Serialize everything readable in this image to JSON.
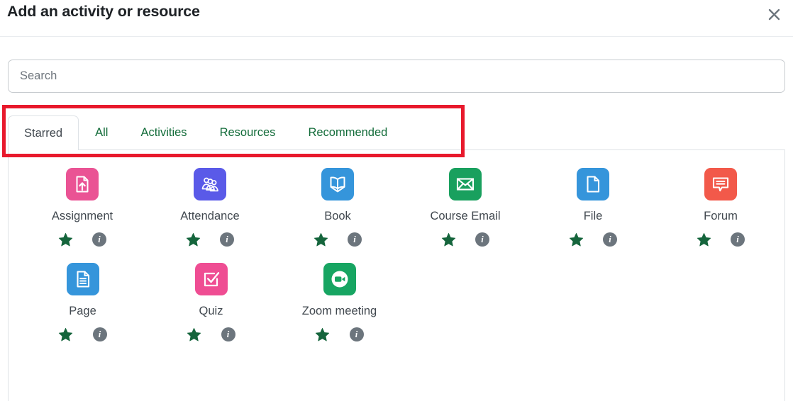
{
  "dialog": {
    "title": "Add an activity or resource",
    "close_label": "×",
    "close_icon": "close-icon"
  },
  "search": {
    "value": "",
    "placeholder": "Search"
  },
  "tabs": [
    {
      "label": "Starred",
      "active": true
    },
    {
      "label": "All",
      "active": false
    },
    {
      "label": "Activities",
      "active": false
    },
    {
      "label": "Resources",
      "active": false
    },
    {
      "label": "Recommended",
      "active": false
    }
  ],
  "annotation": {
    "shape": "rectangle",
    "color": "#e8192c",
    "target": "tab-bar"
  },
  "colors": {
    "tab_link": "#136c3a",
    "tab_active_text": "#41484f",
    "star": "#15653c",
    "info_badge": "#6c757d",
    "annotation": "#e8192c",
    "assignment": "#ea5394",
    "attendance": "#5a5ae8",
    "book": "#3595db",
    "course_email": "#19a05e",
    "file": "#3595db",
    "forum": "#f2594a",
    "page": "#3595db",
    "quiz": "#ef4d93",
    "zoom_meeting": "#17a562"
  },
  "modules": [
    {
      "name": "Assignment",
      "icon": "assignment-icon",
      "color": "#ea5394",
      "starred": true,
      "star_label": "Star Assignment",
      "info_label": "Information about the Assignment activity"
    },
    {
      "name": "Attendance",
      "icon": "attendance-icon",
      "color": "#5a5ae8",
      "starred": true,
      "star_label": "Star Attendance",
      "info_label": "Information about the Attendance activity"
    },
    {
      "name": "Book",
      "icon": "book-icon",
      "color": "#3595db",
      "starred": true,
      "star_label": "Star Book",
      "info_label": "Information about the Book resource"
    },
    {
      "name": "Course Email",
      "icon": "envelope-icon",
      "color": "#19a05e",
      "starred": true,
      "star_label": "Star Course Email",
      "info_label": "Information about the Course Email activity"
    },
    {
      "name": "File",
      "icon": "file-icon",
      "color": "#3595db",
      "starred": true,
      "star_label": "Star File",
      "info_label": "Information about the File resource"
    },
    {
      "name": "Forum",
      "icon": "forum-icon",
      "color": "#f2594a",
      "starred": true,
      "star_label": "Star Forum",
      "info_label": "Information about the Forum activity"
    },
    {
      "name": "Page",
      "icon": "page-icon",
      "color": "#3595db",
      "starred": true,
      "star_label": "Star Page",
      "info_label": "Information about the Page resource"
    },
    {
      "name": "Quiz",
      "icon": "quiz-icon",
      "color": "#ef4d93",
      "starred": true,
      "star_label": "Star Quiz",
      "info_label": "Information about the Quiz activity"
    },
    {
      "name": "Zoom meeting",
      "icon": "video-camera-icon",
      "color": "#17a562",
      "starred": true,
      "star_label": "Star Zoom meeting",
      "info_label": "Information about the Zoom meeting activity"
    }
  ]
}
